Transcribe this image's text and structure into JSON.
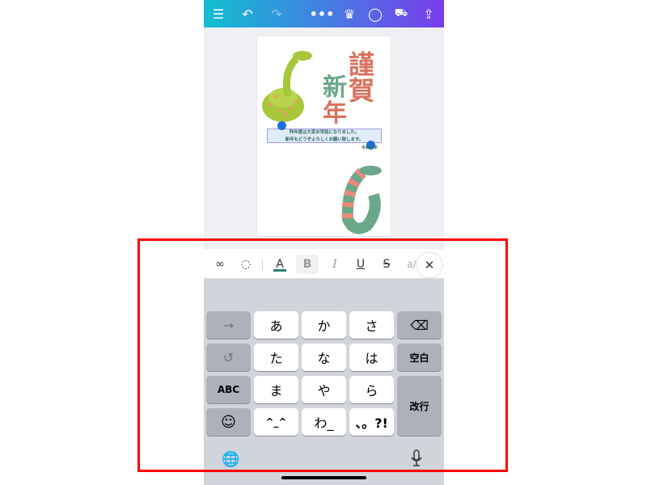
{
  "colors": {
    "topbar_start": "#12bfd0",
    "topbar_end": "#7a3bec",
    "selection_handle": "#1e6fe0",
    "highlight_box": "#ff0000",
    "kanji_red": "#d9725d",
    "kanji_green": "#6aa889"
  },
  "topbar": {
    "icons": [
      "menu-icon",
      "undo-icon",
      "redo-icon",
      "more-icon",
      "crown-icon",
      "comment-icon",
      "truck-icon",
      "share-icon"
    ]
  },
  "card": {
    "kanji_right": [
      "謹",
      "賀"
    ],
    "kanji_left": [
      "新",
      "年"
    ],
    "message_line1": "昨年度は大変お世話になりました。",
    "message_line2": "新年もどうぞよろしくお願い致します。",
    "date": "令和〇年"
  },
  "toolbar": {
    "font_color": "A",
    "bold": "B",
    "italic": "I",
    "underline": "U",
    "strike": "S",
    "more": "a/",
    "close": "✕"
  },
  "keyboard": {
    "rows": [
      [
        "→",
        "あ",
        "か",
        "さ",
        "⌫"
      ],
      [
        "↺",
        "た",
        "な",
        "は",
        "空白"
      ],
      [
        "ABC",
        "ま",
        "や",
        "ら",
        "改行"
      ],
      [
        "☺",
        "^_^",
        "わ_",
        "、。?!"
      ]
    ],
    "globe": "🌐",
    "mic": "mic"
  }
}
